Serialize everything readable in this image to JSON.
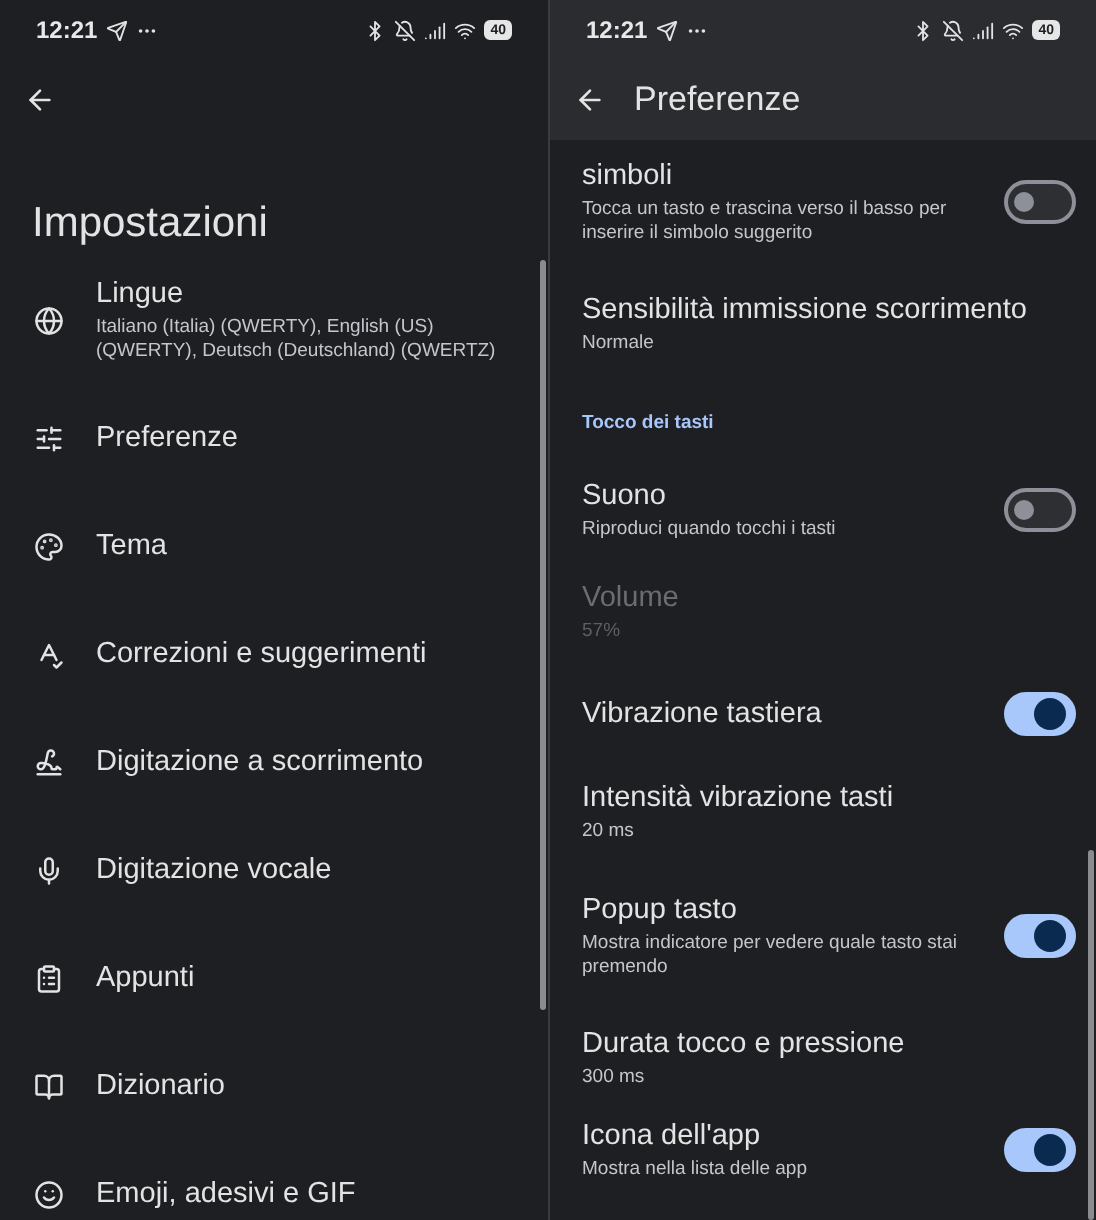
{
  "left_screen": {
    "status_bar": {
      "time": "12:21",
      "battery": "40"
    },
    "title": "Impostazioni",
    "items": [
      {
        "title": "Lingue",
        "subtitle": "Italiano (Italia) (QWERTY), English (US) (QWERTY), Deutsch (Deutschland) (QWERTZ)"
      },
      {
        "title": "Preferenze"
      },
      {
        "title": "Tema"
      },
      {
        "title": "Correzioni e suggerimenti"
      },
      {
        "title": "Digitazione a scorrimento"
      },
      {
        "title": "Digitazione vocale"
      },
      {
        "title": "Appunti"
      },
      {
        "title": "Dizionario"
      },
      {
        "title": "Emoji, adesivi e GIF"
      }
    ]
  },
  "right_screen": {
    "status_bar": {
      "time": "12:21",
      "battery": "40"
    },
    "title": "Preferenze",
    "rows": [
      {
        "kind": "toggle",
        "title": "simboli",
        "subtitle": "Tocca un tasto e trascina verso il basso per inserire il simbolo suggerito",
        "on": false,
        "disabled": false
      },
      {
        "kind": "setting",
        "title": "Sensibilità immissione scorrimento",
        "subtitle": "Normale",
        "disabled": false
      },
      {
        "kind": "section",
        "title": "Tocco dei tasti"
      },
      {
        "kind": "toggle",
        "title": "Suono",
        "subtitle": "Riproduci quando tocchi i tasti",
        "on": false,
        "disabled": false
      },
      {
        "kind": "setting",
        "title": "Volume",
        "subtitle": "57%",
        "disabled": true
      },
      {
        "kind": "toggle",
        "title": "Vibrazione tastiera",
        "on": true,
        "disabled": false
      },
      {
        "kind": "setting",
        "title": "Intensità vibrazione tasti",
        "subtitle": "20 ms",
        "disabled": false
      },
      {
        "kind": "toggle",
        "title": "Popup tasto",
        "subtitle": "Mostra indicatore per vedere quale tasto stai premendo",
        "on": true,
        "disabled": false
      },
      {
        "kind": "setting",
        "title": "Durata tocco e pressione",
        "subtitle": "300 ms",
        "disabled": false
      },
      {
        "kind": "toggle",
        "title": "Icona dell'app",
        "subtitle": "Mostra nella lista delle app",
        "on": true,
        "disabled": false
      }
    ]
  }
}
